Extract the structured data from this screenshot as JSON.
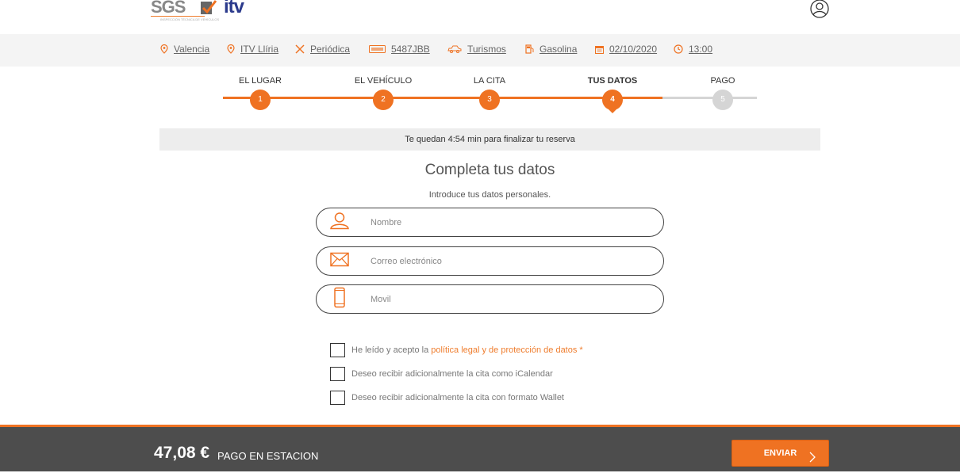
{
  "brand": {
    "sgs": "SGS",
    "sgs_sub": "INSPECCIÓN TÉCNICA DE VEHÍCULOS",
    "itv": "itv",
    "accent": "#ef7222",
    "dark": "#4d4d4d"
  },
  "summary": [
    {
      "icon": "location-pin-icon",
      "label": "Valencia"
    },
    {
      "icon": "location-pin-icon",
      "label": "ITV Llíria"
    },
    {
      "icon": "tools-icon",
      "label": "Periódica"
    },
    {
      "icon": "license-plate-icon",
      "label": "5487JBB"
    },
    {
      "icon": "car-icon",
      "label": "Turismos"
    },
    {
      "icon": "fuel-icon",
      "label": "Gasolina"
    },
    {
      "icon": "calendar-icon",
      "label": "02/10/2020"
    },
    {
      "icon": "clock-icon",
      "label": "13:00"
    }
  ],
  "steps": [
    {
      "label": "EL LUGAR",
      "number": "1",
      "state": "done"
    },
    {
      "label": "EL VEHÍCULO",
      "number": "2",
      "state": "done"
    },
    {
      "label": "LA CITA",
      "number": "3",
      "state": "done"
    },
    {
      "label": "TUS DATOS",
      "number": "4",
      "state": "active"
    },
    {
      "label": "PAGO",
      "number": "5",
      "state": "pending"
    }
  ],
  "timer_text": "Te quedan 4:54 min para finalizar tu reserva",
  "form": {
    "title": "Completa tus datos",
    "subtitle": "Introduce tus datos personales.",
    "name_placeholder": "Nombre",
    "email_placeholder": "Correo electrónico",
    "phone_placeholder": "Movil"
  },
  "checks": {
    "legal_prefix": "He leído y acepto la ",
    "legal_link": "política legal y de protección de datos",
    "legal_required": " *",
    "icalendar": "Deseo recibir adicionalmente la cita como iCalendar",
    "wallet": "Deseo recibir adicionalmente la cita con formato Wallet"
  },
  "footer": {
    "price": "47,08 €",
    "price_label": "PAGO EN ESTACION",
    "send_label": "ENVIAR"
  }
}
